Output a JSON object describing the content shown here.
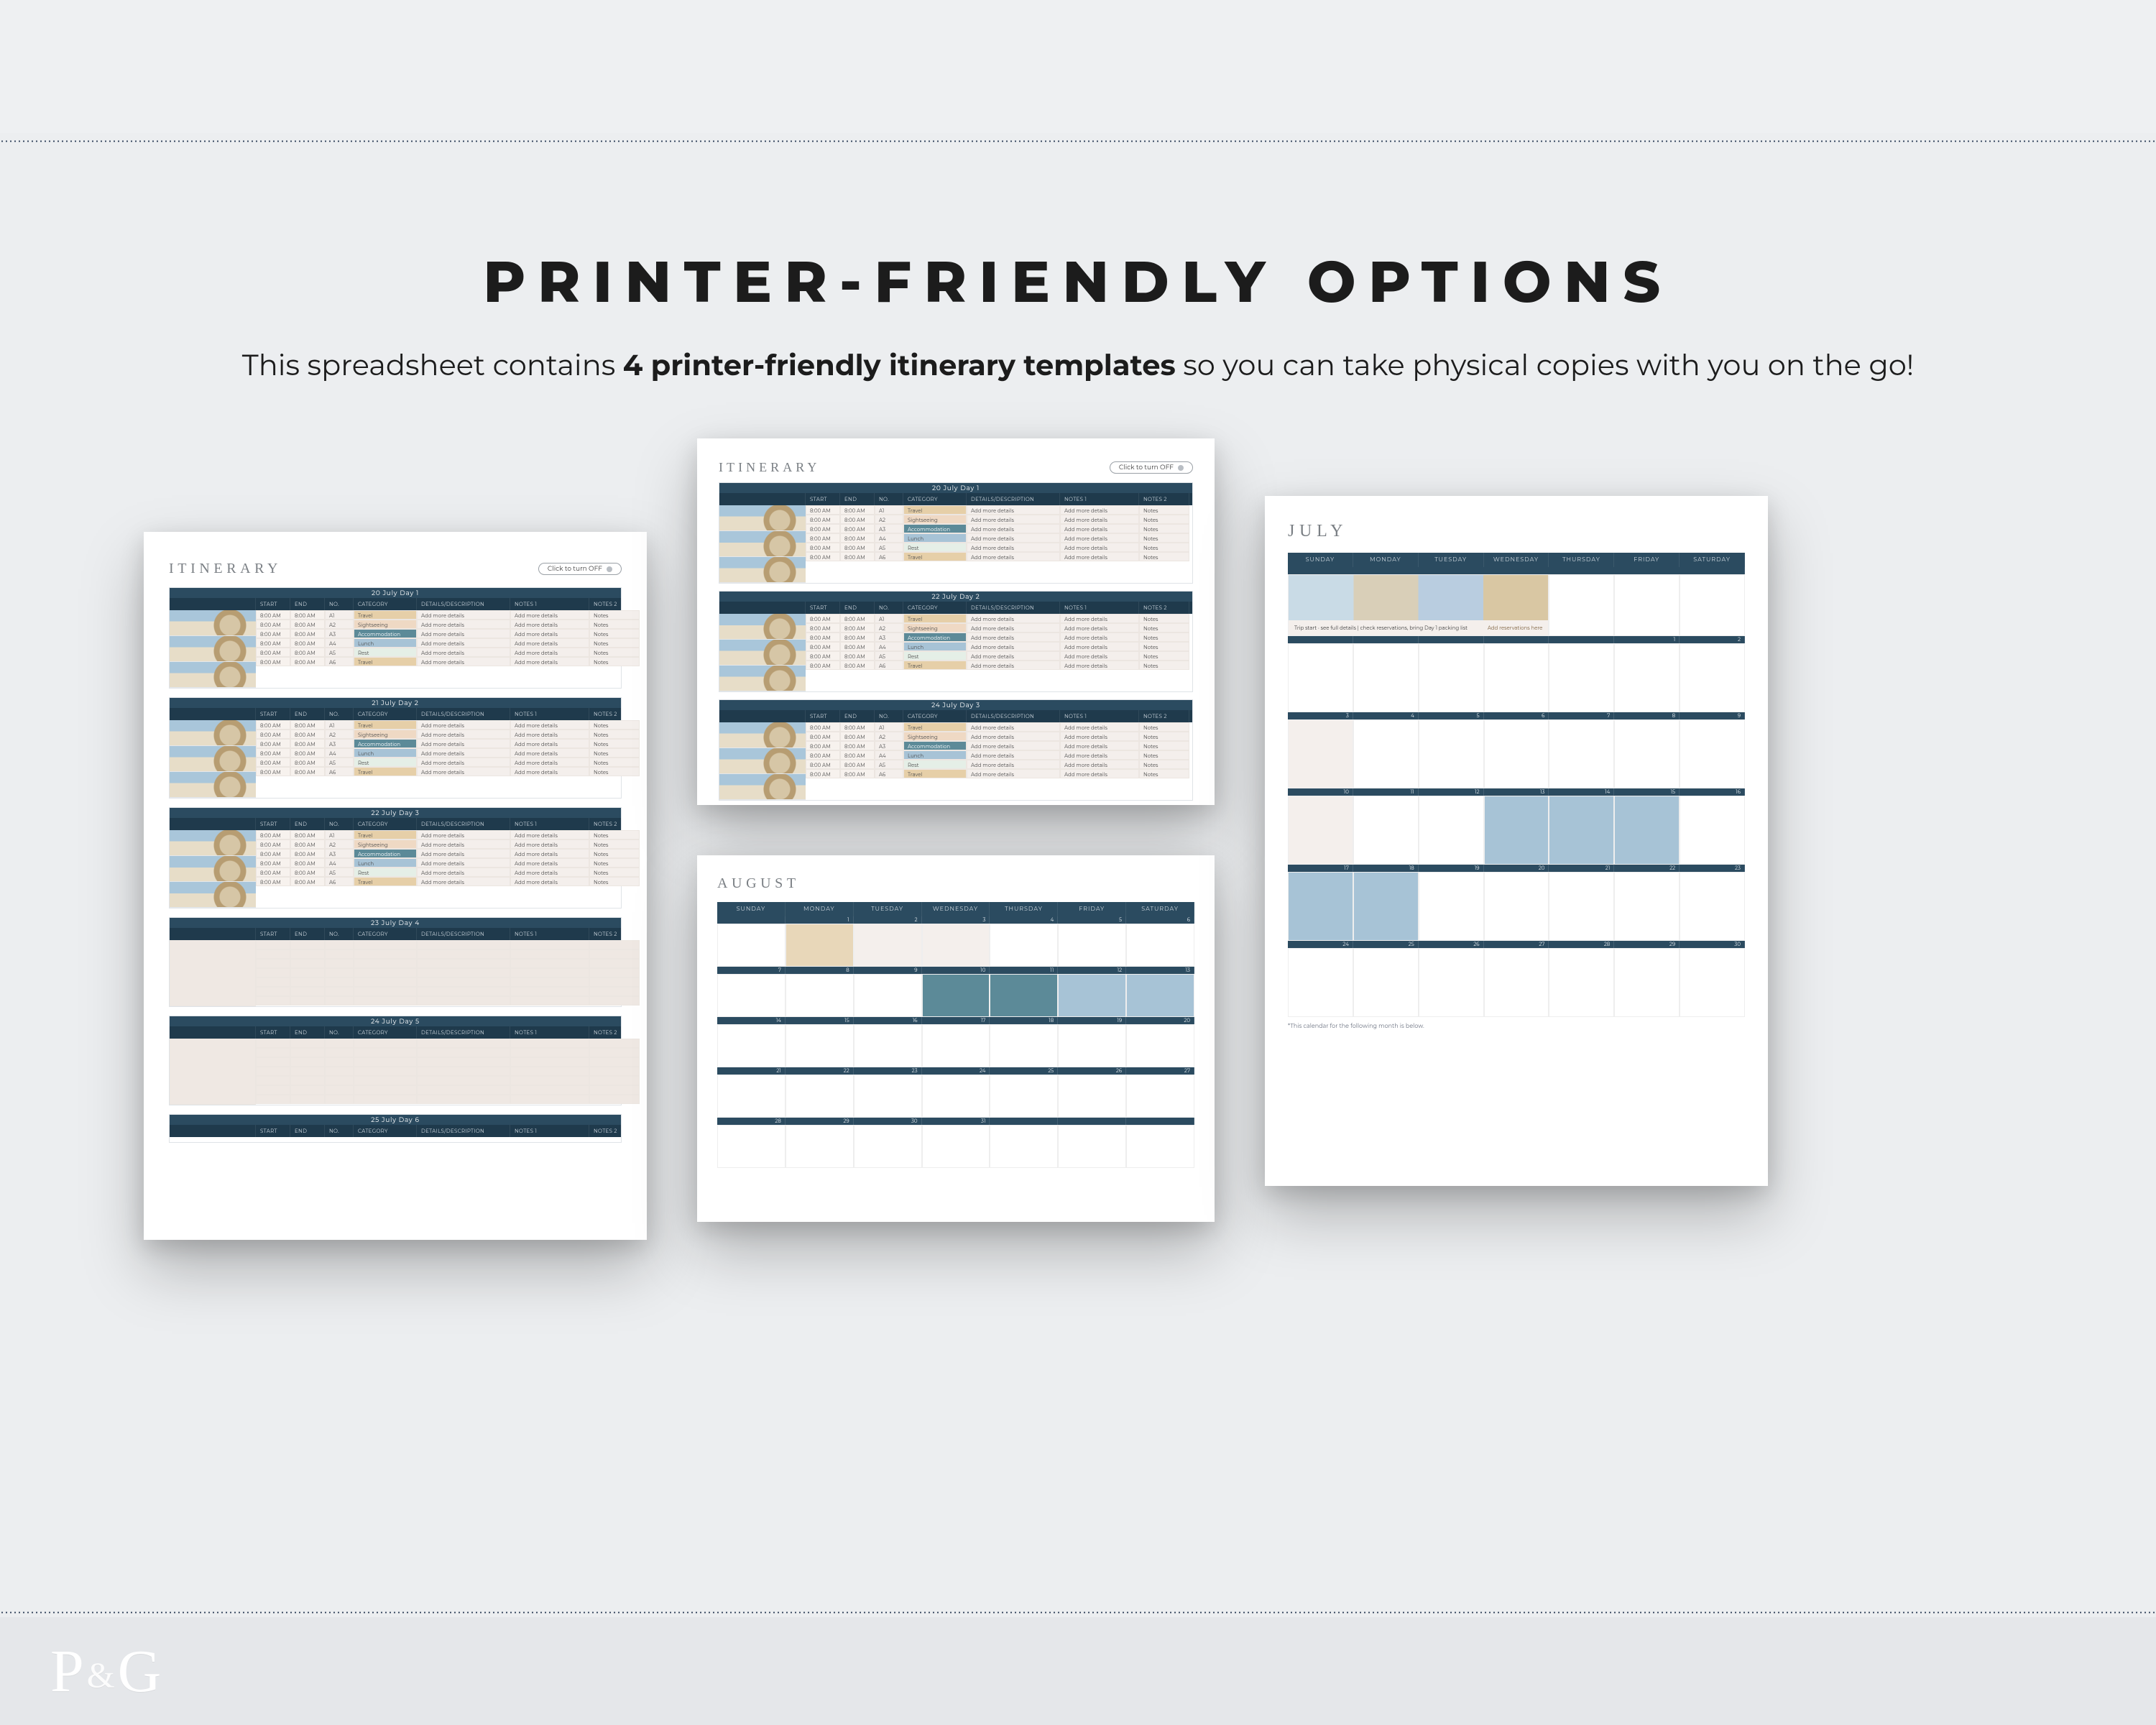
{
  "headline": "PRINTER-FRIENDLY OPTIONS",
  "sub": {
    "a": "This spreadsheet contains ",
    "b": "4 printer-friendly itinerary templates",
    "c": " so you can take physical copies with you on the go!"
  },
  "brand": {
    "p": "P",
    "amp": "&",
    "g": "G"
  },
  "toggle": "Click to turn OFF",
  "itin_word": "ITINERARY",
  "day_labels": [
    "SUNDAY",
    "MONDAY",
    "TUESDAY",
    "WEDNESDAY",
    "THURSDAY",
    "FRIDAY",
    "SATURDAY"
  ],
  "cols": [
    "",
    "START",
    "END",
    "NO.",
    "CATEGORY",
    "DETAILS/DESCRIPTION",
    "NOTES 1",
    "NOTES 2"
  ],
  "rows_sample": [
    [
      "8:00 AM",
      "8:00 AM",
      "A1",
      "Travel",
      "Add more details",
      "Add more details",
      "Notes"
    ],
    [
      "8:00 AM",
      "8:00 AM",
      "A2",
      "Sightseeing",
      "Add more details",
      "Add more details",
      "Notes"
    ],
    [
      "8:00 AM",
      "8:00 AM",
      "A3",
      "Accommodation",
      "Add more details",
      "Add more details",
      "Notes"
    ],
    [
      "8:00 AM",
      "8:00 AM",
      "A4",
      "Lunch",
      "Add more details",
      "Add more details",
      "Notes"
    ],
    [
      "8:00 AM",
      "8:00 AM",
      "A5",
      "Rest",
      "Add more details",
      "Add more details",
      "Notes"
    ],
    [
      "8:00 AM",
      "8:00 AM",
      "A6",
      "Travel",
      "Add more details",
      "Add more details",
      "Notes"
    ]
  ],
  "pageA": {
    "days": [
      "20 July   Day 1",
      "21 July   Day 2",
      "22 July   Day 3",
      "23 July   Day 4",
      "24 July   Day 5",
      "25 July   Day 6"
    ]
  },
  "pageB": {
    "days": [
      "20 July   Day 1",
      "22 July   Day 2",
      "24 July   Day 3"
    ]
  },
  "pageC": {
    "title": "AUGUST",
    "week_dates": [
      [
        "",
        "1",
        "2",
        "3",
        "4",
        "5",
        "6"
      ],
      [
        "7",
        "8",
        "9",
        "10",
        "11",
        "12",
        "13"
      ],
      [
        "14",
        "15",
        "16",
        "17",
        "18",
        "19",
        "20"
      ],
      [
        "21",
        "22",
        "23",
        "24",
        "25",
        "26",
        "27"
      ],
      [
        "28",
        "29",
        "30",
        "31",
        "",
        "",
        ""
      ]
    ]
  },
  "pageD": {
    "title": "JULY",
    "hero_caption": "Trip start · see full details | check reservations, bring Day 1 packing list",
    "hero_link": "Add reservations here",
    "week_dates": [
      [
        "",
        "",
        "",
        "",
        "",
        "1",
        "2"
      ],
      [
        "3",
        "4",
        "5",
        "6",
        "7",
        "8",
        "9"
      ],
      [
        "10",
        "11",
        "12",
        "13",
        "14",
        "15",
        "16"
      ],
      [
        "17",
        "18",
        "19",
        "20",
        "21",
        "22",
        "23"
      ],
      [
        "24",
        "25",
        "26",
        "27",
        "28",
        "29",
        "30"
      ]
    ],
    "footnote": "*This calendar for the following month is below."
  }
}
